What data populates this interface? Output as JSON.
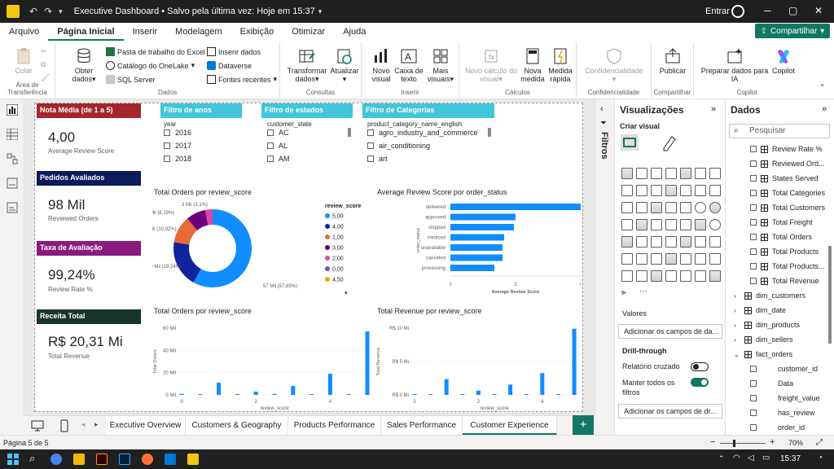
{
  "titlebar": {
    "title": "Executive Dashboard • Salvo pela última vez: Hoje em 15:37",
    "signin": "Entrar"
  },
  "ribbon_tabs": [
    "Arquivo",
    "Página Inicial",
    "Inserir",
    "Modelagem",
    "Exibição",
    "Otimizar",
    "Ajuda"
  ],
  "share_label": "Compartilhar",
  "ribbon": {
    "clipboard": {
      "paste": "Colar",
      "group": "Área de Transferência"
    },
    "data": {
      "get_data": "Obter",
      "get_data2": "dados",
      "excel": "Pasta de trabalho do Excel",
      "onelake": "Catálogo do OneLake",
      "sql": "SQL Server",
      "enter_data": "Inserir dados",
      "dataverse": "Dataverse",
      "recent": "Fontes recentes",
      "group": "Dados"
    },
    "queries": {
      "transform": "Transformar",
      "transform2": "dados",
      "refresh": "Atualizar",
      "group": "Consultas"
    },
    "insert": {
      "new_visual": "Novo",
      "new_visual2": "visual",
      "textbox": "Caixa de",
      "textbox2": "texto",
      "more": "Mais",
      "more2": "visuais",
      "group": "Inserir"
    },
    "calcs": {
      "new_calc": "Novo cálculo do",
      "new_calc2": "visual",
      "new_measure": "Nova",
      "new_measure2": "medida",
      "quick": "Medida",
      "quick2": "rápida",
      "group": "Cálculos"
    },
    "sensitivity": {
      "label": "Confidencialidade",
      "group": "Confidencialidade"
    },
    "share": {
      "publish": "Publicar",
      "group": "Compartilhar"
    },
    "copilot": {
      "prepare": "Preparar dados para",
      "prepare2": "IA",
      "copilot": "Copilot",
      "group": "Copilot"
    }
  },
  "kpis": [
    {
      "title": "Nota Média (de 1 a 5)",
      "value": "4,00",
      "label": "Average Review Score",
      "color": "#a4262c"
    },
    {
      "title": "Pedidos Avaliados",
      "value": "98 Mil",
      "label": "Reviewed Orders",
      "color": "#0b1b5c"
    },
    {
      "title": "Taxa de Avaliação",
      "value": "99,24%",
      "label": "Review Rate %",
      "color": "#8a1a7e"
    },
    {
      "title": "Receita Total",
      "value": "R$ 20,31 Mi",
      "label": "Total Revenue",
      "color": "#17352a"
    }
  ],
  "slicers": {
    "year": {
      "title": "Filtro de anos",
      "field": "year",
      "items": [
        "2016",
        "2017",
        "2018"
      ]
    },
    "state": {
      "title": "Filtro de estados",
      "field": "customer_state",
      "items": [
        "AC",
        "AL",
        "AM"
      ]
    },
    "category": {
      "title": "Filtro de Categorias",
      "field": "product_category_name_english",
      "items": [
        "agro_industry_and_commerce",
        "air_conditioning",
        "art"
      ]
    }
  },
  "chart_titles": {
    "donut": "Total Orders por review_score",
    "hbar": "Average Review Score por order_status",
    "col1": "Total Orders por review_score",
    "col2": "Total Revenue por review_score"
  },
  "chart_data": [
    {
      "type": "pie",
      "title": "Total Orders por review_score",
      "legend_title": "review_score",
      "legend_position": "right",
      "slices": [
        {
          "name": "5,00",
          "value": 57,
          "label": "57 Mil (57,65%)",
          "color": "#118dff"
        },
        {
          "name": "4,00",
          "value": 19,
          "label": "19 Mil (19,24%)",
          "color": "#12239e"
        },
        {
          "name": "1,00",
          "value": 11,
          "label": "11 Mil (10,92%)",
          "color": "#e66c37"
        },
        {
          "name": "3,00",
          "value": 8,
          "label": "8 Mil (8,19%)",
          "color": "#6b007b"
        },
        {
          "name": "2,00",
          "value": 3,
          "label": "3 Mil (3,1%)",
          "color": "#e044a7"
        }
      ],
      "legend": [
        {
          "name": "5,00",
          "color": "#118dff"
        },
        {
          "name": "4,00",
          "color": "#12239e"
        },
        {
          "name": "1,00",
          "color": "#e66c37"
        },
        {
          "name": "3,00",
          "color": "#6b007b"
        },
        {
          "name": "2,00",
          "color": "#e044a7"
        },
        {
          "name": "0,00",
          "color": "#744ec2"
        },
        {
          "name": "4,50",
          "color": "#d9b300"
        }
      ]
    },
    {
      "type": "bar",
      "orientation": "horizontal",
      "title": "Average Review Score por order_status",
      "xlabel": "Average Review Score",
      "ylabel": "order_status",
      "categories": [
        "delivered",
        "approved",
        "shipped",
        "invoiced",
        "unavailable",
        "canceled",
        "processing"
      ],
      "values": [
        4.15,
        2.0,
        1.95,
        1.65,
        1.6,
        1.6,
        1.35
      ],
      "xlim": [
        0,
        4
      ],
      "xticks": [
        "0",
        "2",
        "4"
      ],
      "color": "#118dff"
    },
    {
      "type": "bar",
      "title": "Total Orders por review_score",
      "xlabel": "review_score",
      "ylabel": "Total Orders",
      "x": [
        0,
        0.5,
        1,
        1.5,
        2,
        2.5,
        3,
        3.5,
        4,
        4.5,
        5
      ],
      "values": [
        1,
        0.2,
        11,
        0.3,
        3,
        1,
        8,
        0.5,
        19,
        0.3,
        57
      ],
      "ylim": [
        0,
        60
      ],
      "yticks": [
        "0 Mil",
        "20 Mil",
        "40 Mil",
        "60 Mil"
      ],
      "xticks": [
        "0",
        "2",
        "4"
      ],
      "color": "#118dff"
    },
    {
      "type": "bar",
      "title": "Total Revenue por review_score",
      "xlabel": "review_score",
      "ylabel": "Total Revenue",
      "x": [
        0,
        0.5,
        1,
        1.5,
        2,
        2.5,
        3,
        3.5,
        4,
        4.5,
        5
      ],
      "values": [
        0.15,
        0.02,
        2.6,
        0.05,
        0.7,
        0.1,
        1.7,
        0.1,
        3.6,
        0.05,
        10.9
      ],
      "ylim": [
        0,
        11
      ],
      "yticks": [
        "R$ 0 Mi",
        "R$ 5 Mi",
        "R$ 10 Mi"
      ],
      "xticks": [
        "0",
        "2",
        "4"
      ],
      "color": "#118dff"
    }
  ],
  "filters_label": "Filtros",
  "viz_pane": {
    "title": "Visualizações",
    "build": "Criar visual",
    "values_label": "Valores",
    "values_placeholder": "Adicionar os campos de da...",
    "drill_label": "Drill-through",
    "cross_report": "Relatório cruzado",
    "keep_filters": "Manter todos os",
    "keep_filters2": "filtros",
    "drill_placeholder": "Adicionar os campos de dr...",
    "more": "···"
  },
  "data_pane": {
    "title": "Dados",
    "search": "Pesquisar",
    "measures": [
      "Review Rate %",
      "Reviewed Ord...",
      "States Served",
      "Total Categories",
      "Total Customers",
      "Total Freight",
      "Total Orders",
      "Total Products",
      "Total Products...",
      "Total Revenue"
    ],
    "tables": [
      "dim_customers",
      "dim_date",
      "dim_products",
      "dim_sellers"
    ],
    "expanded_table": "fact_orders",
    "fields": [
      "customer_id",
      "Data",
      "freight_value",
      "has_review",
      "order_id"
    ]
  },
  "pages": [
    "Executive Overview",
    "Customers & Geography",
    "Products Performance",
    "Sales Performance",
    "Customer Experience"
  ],
  "active_page": 4,
  "status": {
    "page": "Página 5 de 5",
    "zoom": "70%"
  },
  "taskbar": {
    "time": "15:37"
  },
  "colors": {
    "accent": "#117865",
    "powerbi_blue": "#118dff",
    "slicer_header": "#41c5d9"
  }
}
